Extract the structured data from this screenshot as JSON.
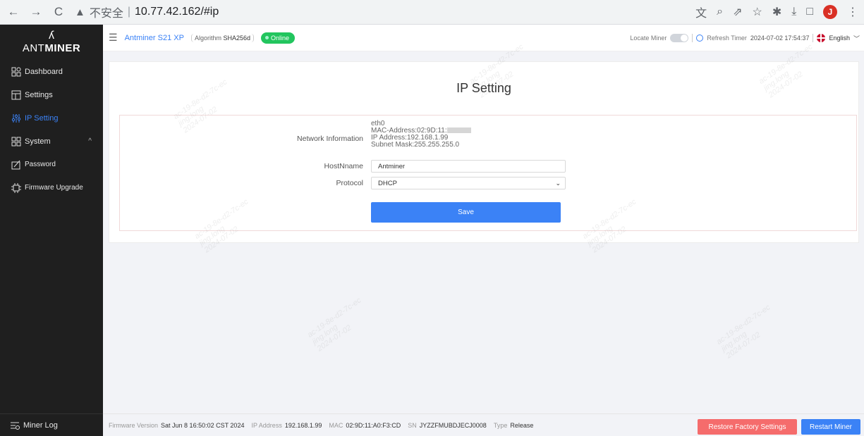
{
  "browser": {
    "back": "←",
    "forward": "→",
    "reload": "C",
    "warning_icon": "▲",
    "insecure_label": "不安全",
    "url": "10.77.42.162/#ip",
    "avatar_letter": "J"
  },
  "sidebar": {
    "logo_text_light": "ANT",
    "logo_text_bold": "MINER",
    "items": [
      {
        "label": "Dashboard",
        "icon": "dashboard-icon"
      },
      {
        "label": "Settings",
        "icon": "settings-icon"
      },
      {
        "label": "IP Setting",
        "icon": "ip-setting-icon",
        "active": true
      },
      {
        "label": "System",
        "icon": "system-icon",
        "arrow": "^"
      },
      {
        "label": "Password",
        "icon": "password-icon"
      },
      {
        "label": "Firmware Upgrade",
        "icon": "firmware-icon"
      }
    ],
    "miner_log": "Miner Log"
  },
  "topbar": {
    "model": "Antminer S21 XP",
    "algorithm_label": "Algorithm",
    "algorithm_value": "SHA256d",
    "status": "Online",
    "locate_label": "Locate Miner",
    "refresh_label": "Refresh Timer",
    "refresh_time": "2024-07-02 17:54:37",
    "language": "English"
  },
  "page": {
    "title": "IP Setting",
    "network_label": "Network Information",
    "network": {
      "iface": "eth0",
      "mac": "MAC-Address:02:9D:11:",
      "ip": "IP Address:192.168.1.99",
      "mask": "Subnet Mask:255.255.255.0"
    },
    "hostname_label": "HostNname",
    "hostname_value": "Antminer",
    "protocol_label": "Protocol",
    "protocol_value": "DHCP",
    "save_label": "Save"
  },
  "footer": {
    "fw_label": "Firmware Version",
    "fw_value": "Sat Jun 8 16:50:02 CST 2024",
    "ip_label": "IP Address",
    "ip_value": "192.168.1.99",
    "mac_label": "MAC",
    "mac_value": "02:9D:11:A0:F3:CD",
    "sn_label": "SN",
    "sn_value": "JYZZFMUBDJECJ0008",
    "type_label": "Type",
    "type_value": "Release",
    "restore_label": "Restore Factory Settings",
    "restart_label": "Restart Miner"
  },
  "colors": {
    "accent": "#3b82f6",
    "online": "#22c55e",
    "danger": "#f56c6c",
    "sidebar_bg": "#1f1f1f"
  }
}
